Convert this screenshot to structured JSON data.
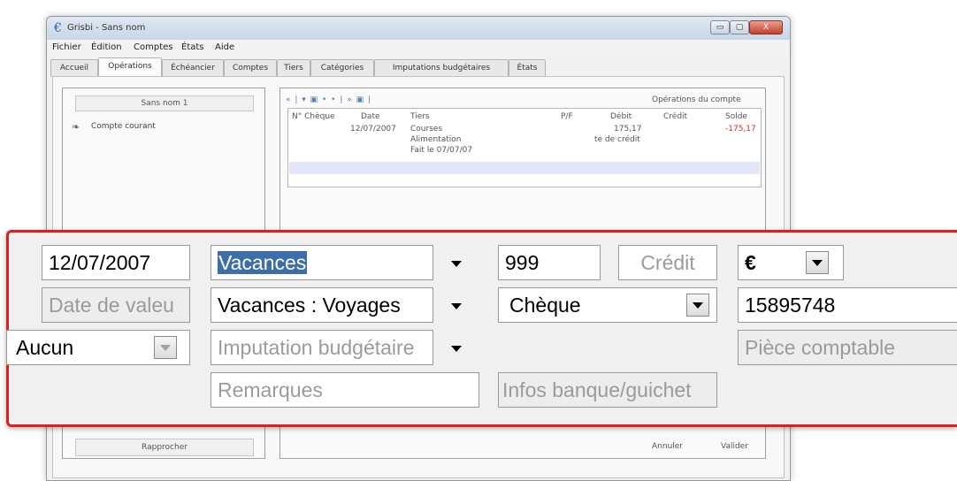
{
  "window": {
    "title": "Grisbi - Sans nom",
    "buttons": {
      "minimize": "▭",
      "maximize": "▢",
      "close": "X"
    }
  },
  "menu": [
    "Fichier",
    "Édition",
    "Comptes",
    "États",
    "Aide"
  ],
  "tabs": [
    "Accueil",
    "Opérations",
    "Échéancier",
    "Comptes",
    "Tiers",
    "Catégories",
    "Imputations budgétaires",
    "États"
  ],
  "active_tab": "Opérations",
  "sidebar": {
    "header": "Sans nom 1",
    "account": "Compte courant",
    "reconcile_button": "Rapprocher"
  },
  "operations": {
    "title": "Opérations du compte",
    "toolbar_glyphs": "« | ▾ ▣ • • | » ▣ |",
    "columns": [
      "N° Chèque",
      "Date",
      "Tiers",
      "P/F",
      "Débit",
      "Crédit",
      "Solde"
    ],
    "rows": [
      {
        "date": "12/07/2007",
        "tiers": "Courses",
        "debit": "175,17",
        "solde": "-175,17",
        "line2_tiers": "Alimentation",
        "line2_debit": "te de crédit",
        "line3_tiers": "Fait le 07/07/07"
      }
    ],
    "cancel": "Annuler",
    "validate": "Valider"
  },
  "form": {
    "date": "12/07/2007",
    "tiers": "Vacances",
    "debit": "999",
    "credit_placeholder": "Crédit",
    "currency": "€",
    "value_date_placeholder": "Date de valeu",
    "category": "Vacances : Voyages",
    "payment_type": "Chèque",
    "cheque_number": "15895748",
    "exercise": "Aucun",
    "budget_placeholder": "Imputation budgétaire",
    "accounting_placeholder": "Pièce comptable",
    "notes_placeholder": "Remarques",
    "bank_info_placeholder": "Infos banque/guichet"
  },
  "colors": {
    "highlight_border": "#e01e1e",
    "negative": "#d03030",
    "selection": "#3d6ea8"
  }
}
